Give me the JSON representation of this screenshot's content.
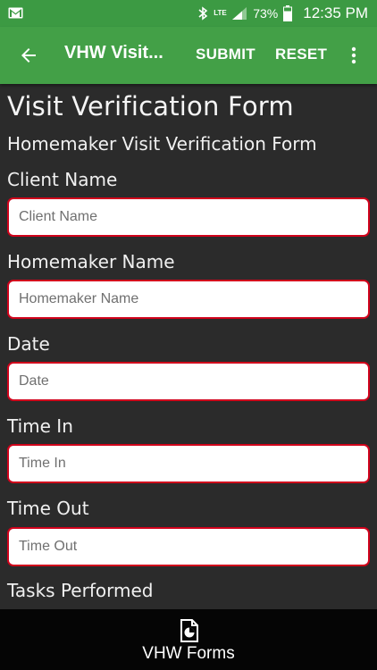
{
  "status_bar": {
    "battery_percent": "73%",
    "time": "12:35 PM",
    "network_label": "LTE",
    "icons": [
      "mail-icon",
      "bluetooth-icon",
      "lte-icon",
      "signal-icon",
      "battery-icon"
    ]
  },
  "app_bar": {
    "title": "VHW Visit...",
    "submit_label": "SUBMIT",
    "reset_label": "RESET",
    "icons": [
      "back-arrow-icon",
      "more-vert-icon"
    ],
    "color": "#43a047"
  },
  "form": {
    "title": "Visit Verification Form",
    "subtitle": "Homemaker Visit Verification Form",
    "fields": [
      {
        "label": "Client Name",
        "placeholder": "Client Name",
        "value": ""
      },
      {
        "label": "Homemaker Name",
        "placeholder": "Homemaker Name",
        "value": ""
      },
      {
        "label": "Date",
        "placeholder": "Date",
        "value": ""
      },
      {
        "label": "Time In",
        "placeholder": "Time In",
        "value": ""
      },
      {
        "label": "Time Out",
        "placeholder": "Time Out",
        "value": ""
      }
    ],
    "next_section_label": "Tasks Performed",
    "field_border_color": "#d0021b"
  },
  "bottom_nav": {
    "label": "VHW Forms",
    "icon": "forms-icon"
  }
}
